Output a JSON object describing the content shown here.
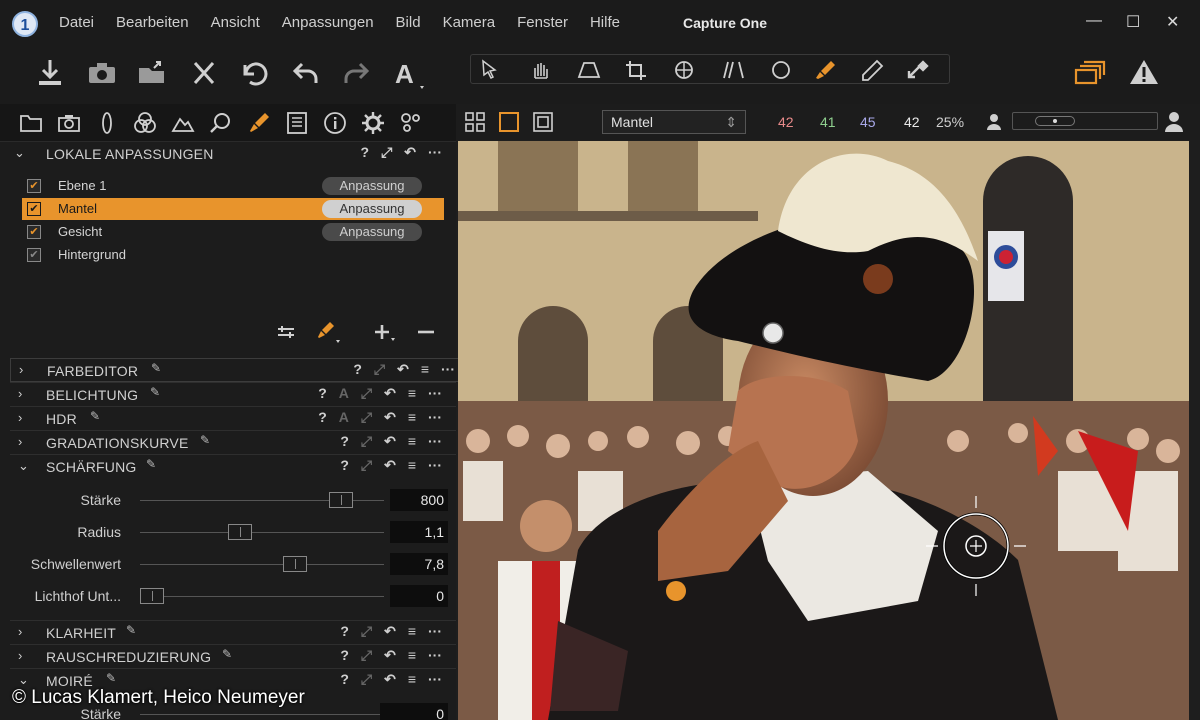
{
  "app": {
    "logo": "1",
    "title": "Capture One"
  },
  "menu": [
    "Datei",
    "Bearbeiten",
    "Ansicht",
    "Anpassungen",
    "Bild",
    "Kamera",
    "Fenster",
    "Hilfe"
  ],
  "window_controls": {
    "minimize": "—",
    "maximize": "☐",
    "close": "✕"
  },
  "toolbar": {
    "left_icons": [
      "import-icon",
      "camera-icon",
      "export-icon",
      "delete-icon",
      "reset-icon",
      "undo-icon",
      "redo-icon",
      "text-icon"
    ],
    "tools": [
      "cursor-icon",
      "pan-icon",
      "keystone-icon",
      "crop-icon",
      "rotate-icon",
      "straighten-icon",
      "circle-icon",
      "brush-icon",
      "picker-icon",
      "apply-icon"
    ],
    "right_icons": [
      "stack-icon",
      "warning-icon"
    ],
    "accent": "#e8942c"
  },
  "left_tabs": [
    "folder-icon",
    "camera-icon",
    "lens-icon",
    "color-icon",
    "exposure-icon",
    "search-icon",
    "brush-icon",
    "metadata-icon",
    "info-icon",
    "settings-icon",
    "batch-icon"
  ],
  "local_adjust": {
    "title": "LOKALE ANPASSUNGEN",
    "layers": [
      {
        "name": "Ebene 1",
        "pill": "Anpassung",
        "checked": true
      },
      {
        "name": "Mantel",
        "pill": "Anpassung",
        "checked": true
      },
      {
        "name": "Gesicht",
        "pill": "Anpassung",
        "checked": true
      },
      {
        "name": "Hintergrund",
        "pill": "",
        "checked": true
      }
    ]
  },
  "sections": {
    "farbeditor": "FARBEDITOR",
    "belichtung": "BELICHTUNG",
    "hdr": "HDR",
    "gradation": "GRADATIONSKURVE",
    "schaerfung": "SCHÄRFUNG",
    "klarheit": "KLARHEIT",
    "rausch": "RAUSCHREDUZIERUNG",
    "moire": "MOIRÉ"
  },
  "sharpening": [
    {
      "label": "Stärke",
      "value": "800",
      "pos": 0.86
    },
    {
      "label": "Radius",
      "value": "1,1",
      "pos": 0.4
    },
    {
      "label": "Schwellenwert",
      "value": "7,8",
      "pos": 0.65
    },
    {
      "label": "Lichthof Unt...",
      "value": "0",
      "pos": 0.0
    }
  ],
  "moire_row": {
    "label": "Stärke",
    "value": "0"
  },
  "viewer": {
    "layer_select": "Mantel",
    "readouts": [
      {
        "text": "42",
        "color": "#e88a8a"
      },
      {
        "text": "41",
        "color": "#8fd08f"
      },
      {
        "text": "45",
        "color": "#a9a9ea"
      },
      {
        "text": "42",
        "color": "#e8e8e8"
      }
    ],
    "zoom": "25%"
  },
  "credit": "© Lucas Klamert, Heico Neumeyer"
}
